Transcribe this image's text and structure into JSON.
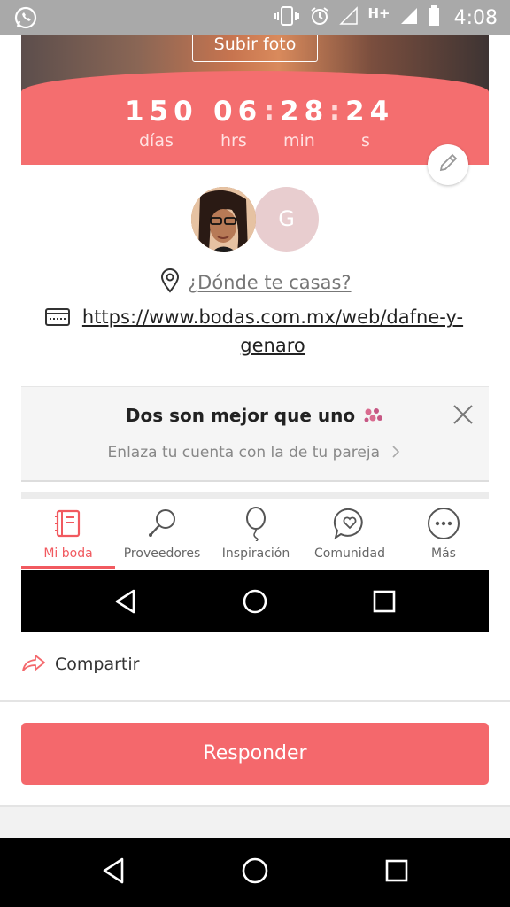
{
  "status_bar": {
    "time": "4:08",
    "network": "H+",
    "icons": [
      "whatsapp-icon",
      "vibrate-icon",
      "alarm-icon",
      "signal-empty-icon",
      "signal-icon",
      "battery-icon"
    ]
  },
  "hero": {
    "upload_label": "Subir foto",
    "countdown": {
      "days": "150",
      "days_label": "días",
      "hours": "06",
      "hours_label": "hrs",
      "minutes": "28",
      "minutes_label": "min",
      "seconds": "24",
      "seconds_label": "s"
    }
  },
  "profile": {
    "partner_initial": "G",
    "where_label": "¿Dónde te casas?",
    "web_link": "https://www.bodas.com.mx/web/dafne-y-genaro"
  },
  "partner_card": {
    "title": "Dos son mejor que uno",
    "subtitle": "Enlaza tu cuenta con la de tu pareja"
  },
  "tabs": [
    {
      "label": "Mi boda",
      "icon": "notebook-icon",
      "active": true
    },
    {
      "label": "Proveedores",
      "icon": "search-icon",
      "active": false
    },
    {
      "label": "Inspiración",
      "icon": "balloon-icon",
      "active": false
    },
    {
      "label": "Comunidad",
      "icon": "chat-heart-icon",
      "active": false
    },
    {
      "label": "Más",
      "icon": "more-icon",
      "active": false
    }
  ],
  "actions": {
    "share_label": "Compartir",
    "reply_label": "Responder"
  },
  "colors": {
    "accent": "#f4686c",
    "status_bar": "#a9a9a9",
    "nav_bar": "#000000"
  }
}
